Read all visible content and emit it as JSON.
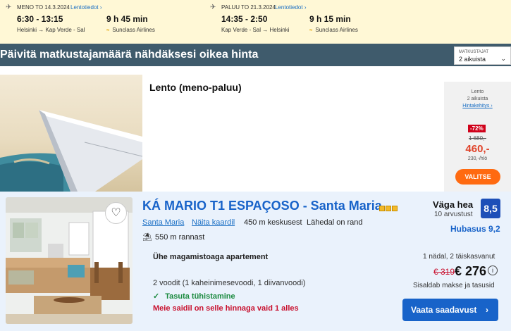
{
  "flights": {
    "outbound": {
      "label": "MENO TO 14.3.2024",
      "details_link": "Lentotiedot",
      "times": "6:30 - 13:15",
      "route": "Helsinki → Kap Verde - Sal",
      "duration": "9 h 45 min",
      "airline": "Sunclass Airlines"
    },
    "return": {
      "label": "PALUU TO 21.3.2024",
      "details_link": "Lentotiedot",
      "times": "14:35 - 2:50",
      "route": "Kap Verde - Sal → Helsinki",
      "duration": "9 h 15 min",
      "airline": "Sunclass Airlines"
    }
  },
  "banner": {
    "text": "Päivitä matkustajamäärä nähdäksesi oikea hinta",
    "travelers_label": "MATKUSTAJAT",
    "travelers_value": "2 aikuista"
  },
  "flight_offer": {
    "title": "Lento (meno-paluu)",
    "panel_label": "Lento",
    "pax": "2 aikuista",
    "price_history_link": "Hintakehitys",
    "discount": "-72%",
    "old_price": "1 680,-",
    "new_price": "460,-",
    "per_person": "230,-/hlö",
    "select_button": "VALITSE"
  },
  "hotel": {
    "name": "KÁ MARIO T1 ESPAÇOSO - Santa Maria",
    "star_count": 3,
    "location_link": "Santa Maria",
    "map_link": "Näita kaardil",
    "distance_center": "450 m keskusest",
    "near_beach": "Lähedal on rand",
    "beach_distance": "550 m rannast",
    "rating_word": "Väga hea",
    "reviews": "10 arvustust",
    "score": "8,5",
    "cleanliness": "Hubasus 9,2",
    "room_type": "Ühe magamistoaga apartement",
    "beds": "2 voodit (1 kaheinimesevoodi, 1 diivanvoodi)",
    "free_cancellation": "Tasuta tühistamine",
    "scarcity": "Meie saidil on selle hinnaga vaid 1 alles",
    "stay": "1 nädal, 2 täiskasvanut",
    "old_price": "€ 319",
    "new_price": "€ 276",
    "includes": "Sisaldab makse ja tasusid",
    "cta": "Vaata saadavust"
  },
  "icons": {
    "plane": "plane-icon",
    "heart": "heart-icon",
    "beach": "beach-icon",
    "check": "check-icon",
    "info": "info-icon",
    "chevron": "chevron-right-icon"
  },
  "colors": {
    "brand_blue": "#1863c9",
    "banner": "#3f5b6c",
    "flight_strip": "#fff8d6",
    "cta_orange": "#ff6a10",
    "discount_red": "#d0021b",
    "hotel_card_bg": "#eaf2fc"
  }
}
